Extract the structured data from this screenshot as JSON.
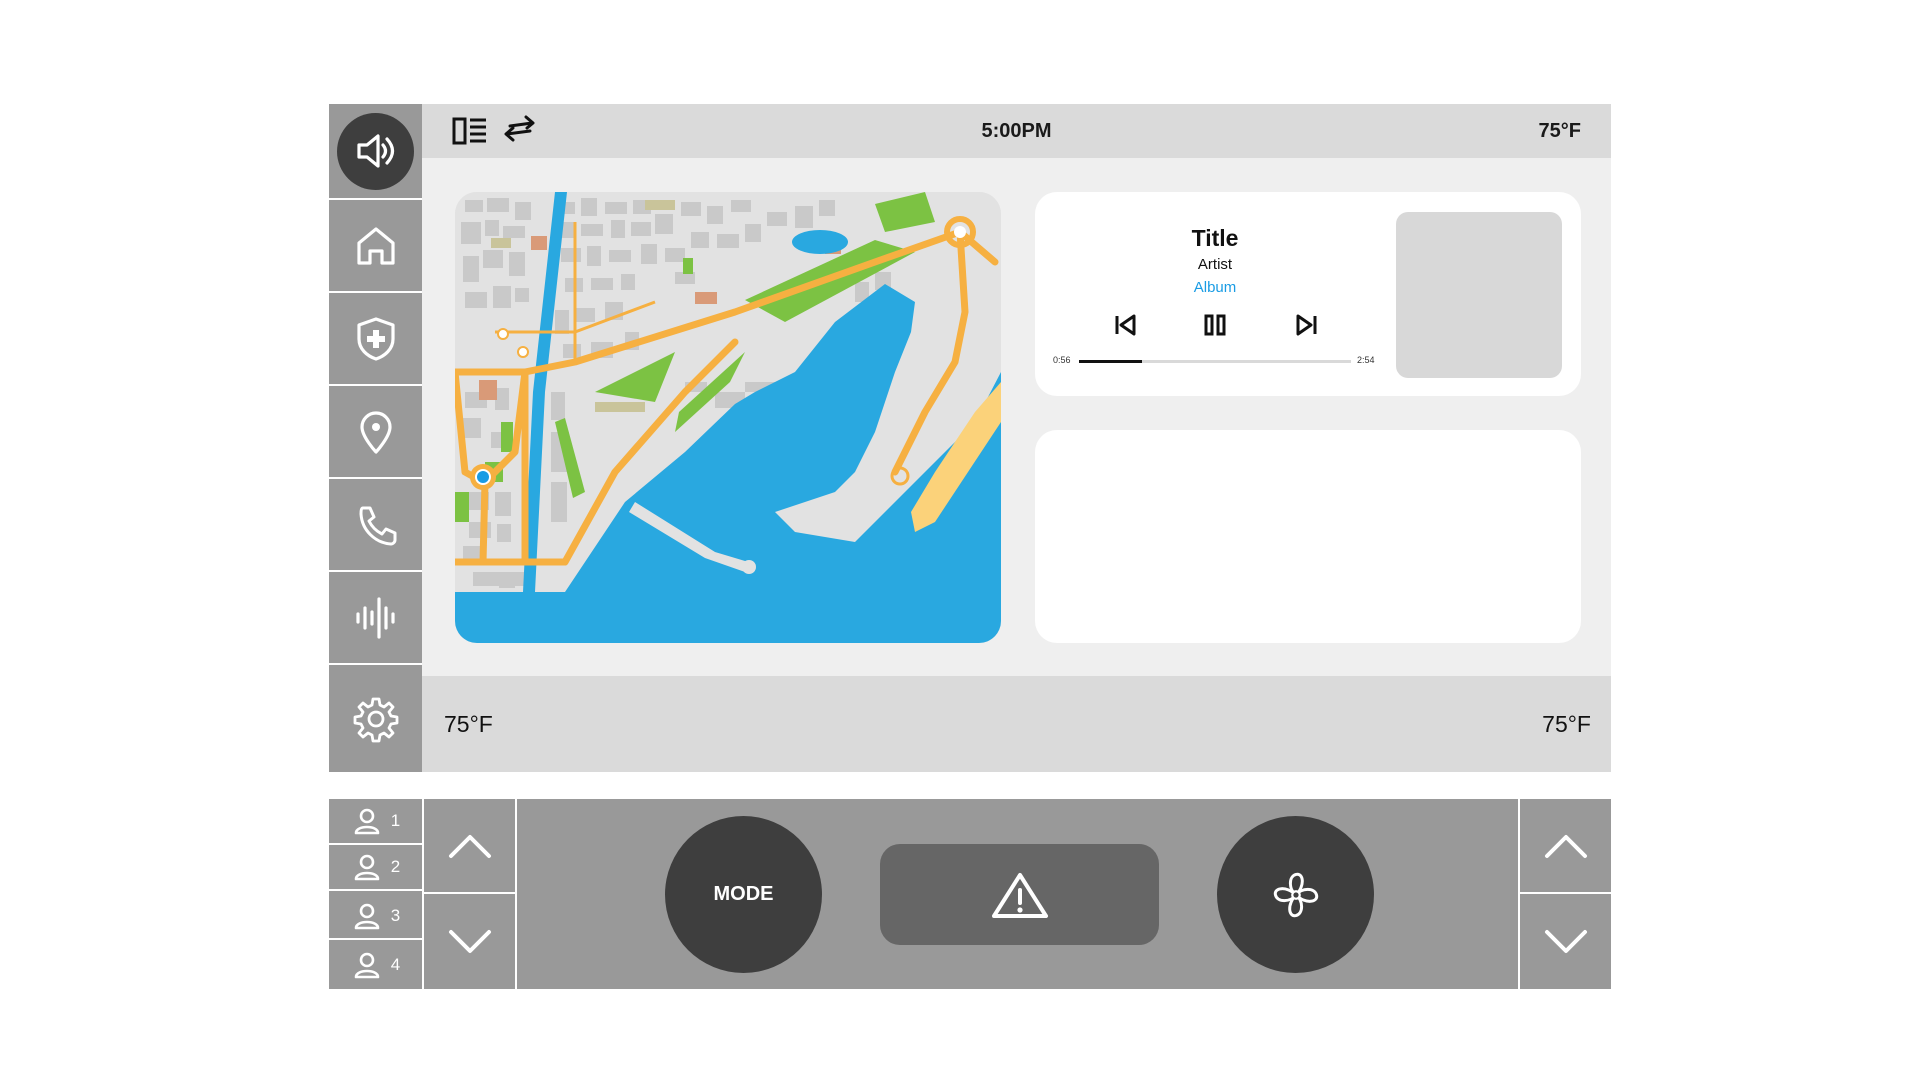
{
  "sidebar": {
    "items": [
      {
        "name": "volume",
        "icon": "speaker-icon",
        "active": true
      },
      {
        "name": "home",
        "icon": "home-icon"
      },
      {
        "name": "safety",
        "icon": "shield-plus-icon"
      },
      {
        "name": "navigation",
        "icon": "location-pin-icon"
      },
      {
        "name": "phone",
        "icon": "phone-icon"
      },
      {
        "name": "voice",
        "icon": "sound-wave-icon"
      },
      {
        "name": "settings",
        "icon": "gear-icon"
      }
    ]
  },
  "status_bar": {
    "layout_icon": "split-list-icon",
    "swap_icon": "swap-arrows-icon",
    "time": "5:00PM",
    "outside_temp": "75°F"
  },
  "map": {
    "icon": "city-map",
    "colors": {
      "water": "#29a8e0",
      "route": "#f6b041",
      "park": "#7cc243",
      "beach": "#fbd27a",
      "block": "#c8c8c8"
    }
  },
  "media": {
    "title": "Title",
    "artist": "Artist",
    "album": "Album",
    "elapsed": "0:56",
    "duration": "2:54",
    "progress": 0.23,
    "prev_icon": "skip-previous-icon",
    "pause_icon": "pause-icon",
    "next_icon": "skip-next-icon"
  },
  "climate": {
    "driver_temp": "75°F",
    "passenger_temp": "75°F"
  },
  "controls": {
    "profiles": [
      {
        "label": "1"
      },
      {
        "label": "2"
      },
      {
        "label": "3"
      },
      {
        "label": "4"
      }
    ],
    "mode_label": "MODE",
    "hazard_icon": "hazard-warning-icon",
    "fan_icon": "fan-icon",
    "up_icon": "chevron-up-icon",
    "down_icon": "chevron-down-icon"
  },
  "colors": {
    "accent": "#1a9ce4",
    "dark_button": "#3e3e3e",
    "panel_gray": "#999999",
    "bar_gray": "#dadada"
  }
}
